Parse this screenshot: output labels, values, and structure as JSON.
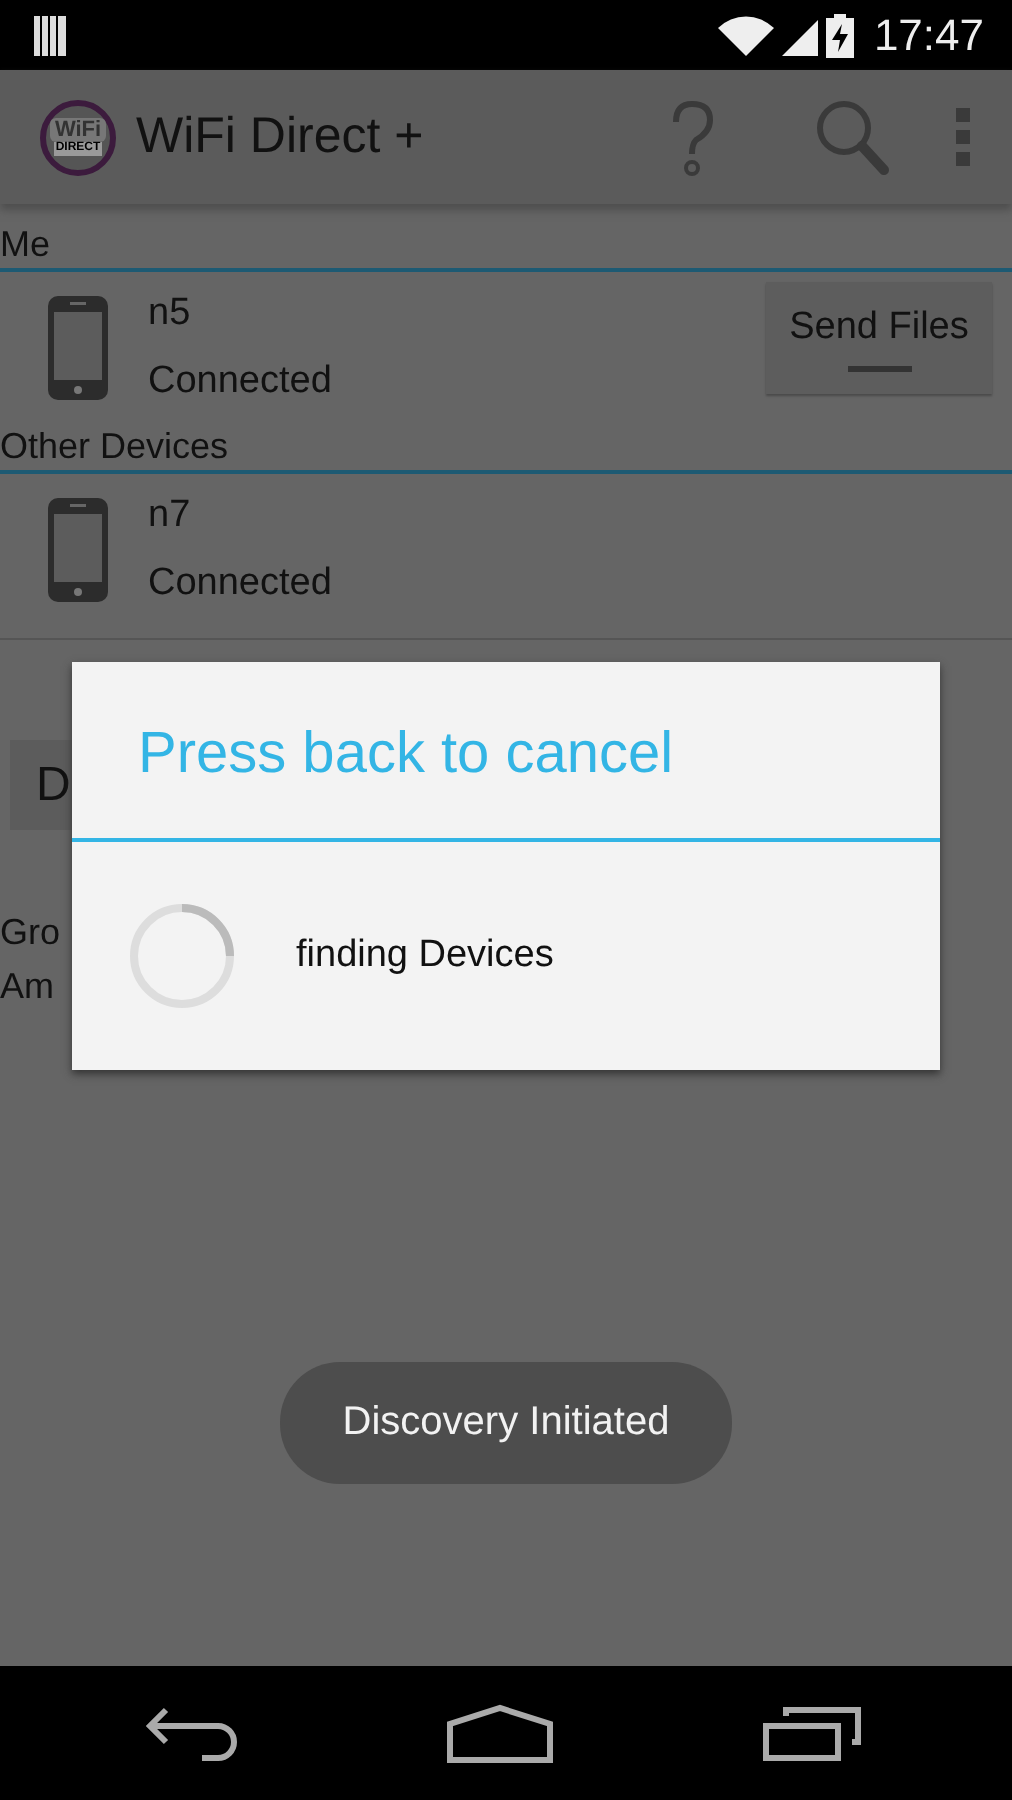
{
  "status_bar": {
    "time": "17:47"
  },
  "action_bar": {
    "logo": {
      "top": "WiFi",
      "bottom": "DIRECT"
    },
    "title": "WiFi Direct +",
    "actions": [
      {
        "kind": "help"
      },
      {
        "kind": "search"
      },
      {
        "kind": "overflow"
      }
    ]
  },
  "sections": [
    {
      "title": "Me",
      "devices": [
        {
          "name": "n5",
          "status": "Connected",
          "button": "Send Files"
        }
      ]
    },
    {
      "title": "Other Devices",
      "devices": [
        {
          "name": "n7",
          "status": "Connected"
        }
      ]
    }
  ],
  "partial_button": "D",
  "partial_lines": [
    "Gro",
    "Am"
  ],
  "dialog": {
    "title": "Press back to cancel",
    "message": "finding Devices"
  },
  "toast": "Discovery Initiated"
}
